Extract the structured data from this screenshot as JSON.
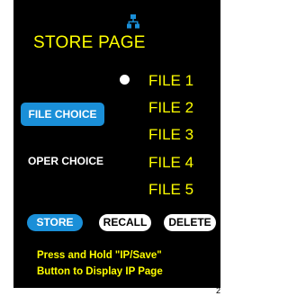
{
  "header": {
    "title": "STORE PAGE",
    "network_icon": "network-icon"
  },
  "files": [
    {
      "label": "FILE 1",
      "selected": true
    },
    {
      "label": "FILE 2",
      "selected": false
    },
    {
      "label": "FILE 3",
      "selected": false
    },
    {
      "label": "FILE 4",
      "selected": false
    },
    {
      "label": "FILE 5",
      "selected": false
    }
  ],
  "choices": {
    "file_choice": "FILE CHOICE",
    "oper_choice": "OPER CHOICE"
  },
  "actions": {
    "store": "STORE",
    "recall": "RECALL",
    "delete": "DELETE"
  },
  "hint": {
    "line1": "Press and Hold \"IP/Save\"",
    "line2": "Button to Display IP Page"
  },
  "corner_text": "2",
  "colors": {
    "background": "#000000",
    "title": "#ffff00",
    "accent": "#1a8fd8",
    "selected_bullet": "#ffffff"
  }
}
